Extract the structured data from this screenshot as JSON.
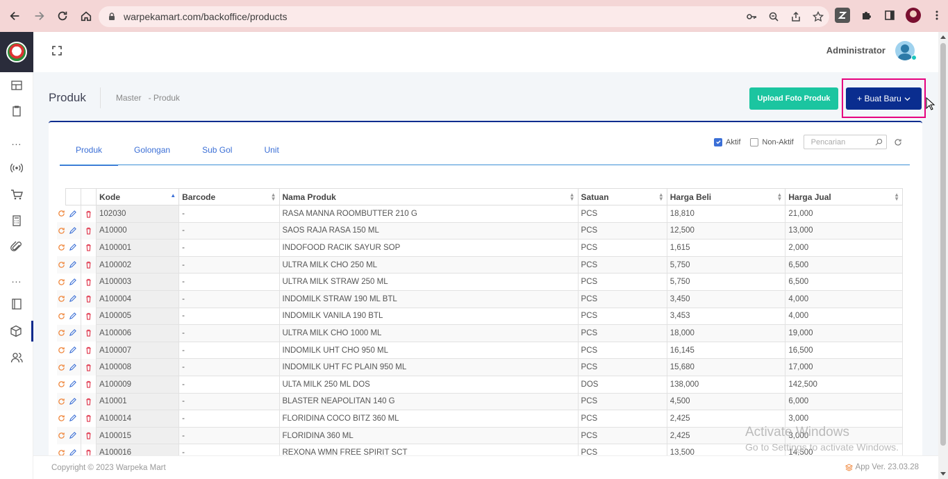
{
  "browser": {
    "url": "warpekamart.com/backoffice/products"
  },
  "header": {
    "user_name": "Administrator"
  },
  "page": {
    "title": "Produk",
    "breadcrumb_1": "Master",
    "breadcrumb_2": "- Produk",
    "upload_button": "Upload Foto Produk",
    "new_button": "+ Buat Baru"
  },
  "tabs": [
    "Produk",
    "Golongan",
    "Sub Gol",
    "Unit"
  ],
  "filters": {
    "active_label": "Aktif",
    "active_checked": true,
    "inactive_label": "Non-Aktif",
    "inactive_checked": false,
    "search_placeholder": "Pencarian"
  },
  "table": {
    "columns": [
      "Kode",
      "Barcode",
      "Nama Produk",
      "Satuan",
      "Harga Beli",
      "Harga Jual"
    ],
    "rows": [
      [
        "102030",
        "-",
        "RASA MANNA ROOMBUTTER 210 G",
        "PCS",
        "18,810",
        "21,000"
      ],
      [
        "A10000",
        "-",
        "SAOS RAJA RASA 150 ML",
        "PCS",
        "12,500",
        "13,000"
      ],
      [
        "A100001",
        "-",
        "INDOFOOD RACIK SAYUR SOP",
        "PCS",
        "1,615",
        "2,000"
      ],
      [
        "A100002",
        "-",
        "ULTRA MILK CHO 250 ML",
        "PCS",
        "5,750",
        "6,500"
      ],
      [
        "A100003",
        "-",
        "ULTRA MILK STRAW 250 ML",
        "PCS",
        "5,750",
        "6,500"
      ],
      [
        "A100004",
        "-",
        "INDOMILK STRAW 190 ML BTL",
        "PCS",
        "3,450",
        "4,000"
      ],
      [
        "A100005",
        "-",
        "INDOMILK VANILA 190 BTL",
        "PCS",
        "3,453",
        "4,000"
      ],
      [
        "A100006",
        "-",
        "ULTRA MILK CHO 1000 ML",
        "PCS",
        "18,000",
        "19,000"
      ],
      [
        "A100007",
        "-",
        "INDOMILK UHT CHO 950 ML",
        "PCS",
        "16,145",
        "16,500"
      ],
      [
        "A100008",
        "-",
        "INDOMILK UHT FC PLAIN 950 ML",
        "PCS",
        "15,680",
        "17,000"
      ],
      [
        "A100009",
        "-",
        "ULTA MILK 250 ML DOS",
        "DOS",
        "138,000",
        "142,500"
      ],
      [
        "A10001",
        "-",
        "BLASTER NEAPOLITAN 140 G",
        "PCS",
        "4,500",
        "6,000"
      ],
      [
        "A100014",
        "-",
        "FLORIDINA COCO BITZ 360 ML",
        "PCS",
        "2,425",
        "3,000"
      ],
      [
        "A100015",
        "-",
        "FLORIDINA 360 ML",
        "PCS",
        "2,425",
        "3,000"
      ],
      [
        "A100016",
        "-",
        "REXONA WMN FREE SPIRIT SCT",
        "PCS",
        "13,500",
        "14,500"
      ]
    ]
  },
  "watermark": {
    "line1": "Activate Windows",
    "line2": "Go to Settings to activate Windows."
  },
  "footer": {
    "copyright": "Copyright © 2023 Warpeka Mart",
    "version": "App Ver. 23.03.28"
  },
  "colors": {
    "primary": "#0a2d8f",
    "success": "#1bc5a0",
    "highlight": "#e6007e",
    "action_orange": "#f0883e",
    "action_blue": "#3b6fd6",
    "action_red": "#e0344a"
  }
}
